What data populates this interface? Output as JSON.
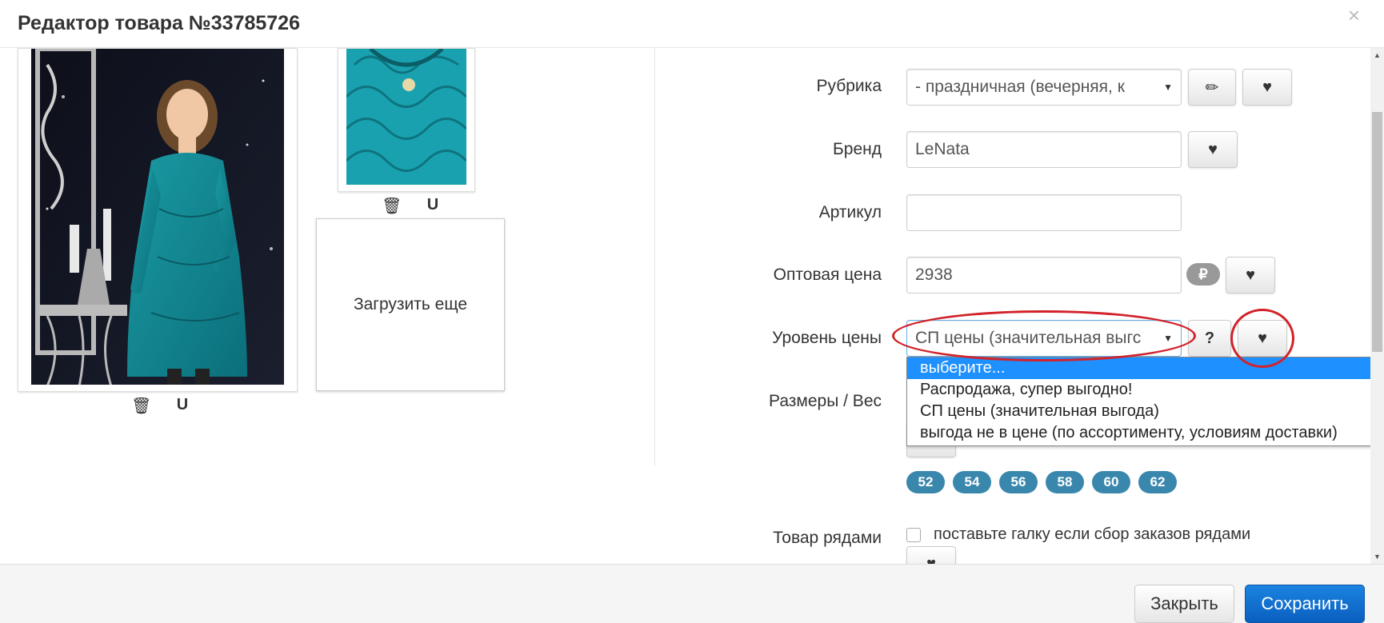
{
  "header": {
    "title": "Редактор товара №33785726",
    "close_glyph": "×"
  },
  "images": {
    "upload_more_label": "Загрузить еще",
    "delete_glyph": "🗑",
    "magnet_glyph": "U"
  },
  "form": {
    "rubric": {
      "label": "Рубрика",
      "value": "-  праздничная (вечерняя, к"
    },
    "brand": {
      "label": "Бренд",
      "value": "LeNata"
    },
    "article": {
      "label": "Артикул",
      "value": ""
    },
    "wholesale_price": {
      "label": "Оптовая цена",
      "value": "2938",
      "currency_badge": "₽"
    },
    "price_level": {
      "label": "Уровень цены",
      "value": "СП цены (значительная выгс",
      "help_label": "?",
      "options": [
        "выберите...",
        "Распродажа, супер выгодно!",
        "СП цены (значительная выгода)",
        "выгода не в цене (по ассортименту, условиям доставки)"
      ],
      "highlighted_option": "выберите..."
    },
    "sizes": {
      "label": "Размеры / Вес",
      "tags": [
        "52",
        "54",
        "56",
        "58",
        "60",
        "62"
      ]
    },
    "rows": {
      "label": "Товар рядами",
      "checkbox_text": "поставьте галку если сбор заказов рядами"
    }
  },
  "icons": {
    "pencil": "✏",
    "heart": "♥",
    "caret": "▼"
  },
  "footer": {
    "close_label": "Закрыть",
    "save_label": "Сохранить"
  },
  "colors": {
    "accent": "#0a5fbf",
    "annotation": "#d2232a",
    "tag": "#3a87ad",
    "dropdown_highlight": "#1e90ff"
  }
}
